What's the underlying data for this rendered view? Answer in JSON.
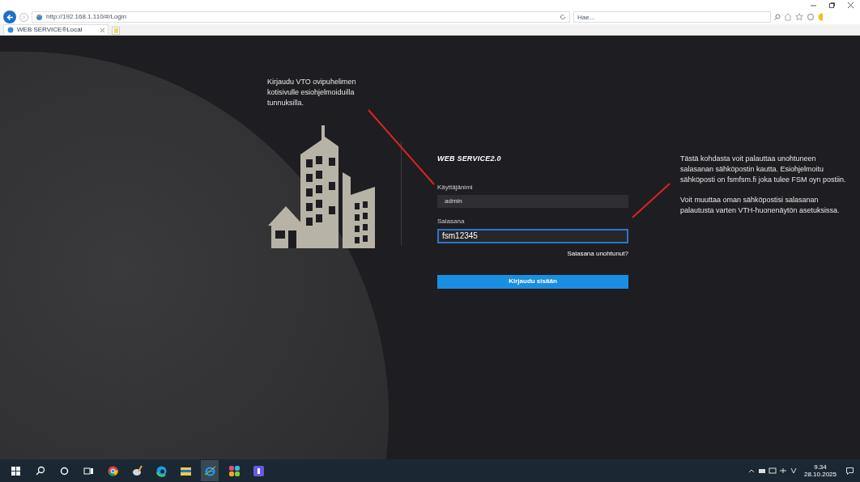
{
  "browser": {
    "url": "http://192.168.1.110/#/Login",
    "search": {
      "placeholder": "Hae..."
    },
    "tabs": [
      {
        "title": "WEB SERVICE®Local",
        "selected": true
      }
    ]
  },
  "annotations": [
    {
      "paragraphs": [
        "Kirjaudu VTO ovipuhelimen kotisivulle esiohjelmoiduilla tunnuksilla."
      ]
    },
    {
      "paragraphs": [
        "Tästä kohdasta voit palauttaa unohtuneen salasanan sähköpostin kautta. Esiohjelmoitu sähköposti on fsmfsm.fi joka tulee FSM oyn postiin.",
        "Voit muuttaa oman sähköpostisi salasanan palautusta varten VTH-huonenäytön asetuksissa."
      ]
    }
  ],
  "login": {
    "title": "WEB SERVICE2.0",
    "fields": [
      {
        "label": "Käyttäjänimi",
        "value": "admin",
        "focused": false
      },
      {
        "label": "Salasana",
        "value": "fsm12345",
        "focused": true
      }
    ],
    "forgot_link": "Salasana unohtunut?",
    "submit": "Kirjaudu sisään"
  },
  "taskbar": {
    "apps": [
      {
        "kind": "start",
        "selected": false
      },
      {
        "kind": "search",
        "selected": false
      },
      {
        "kind": "cortana",
        "selected": false
      },
      {
        "kind": "taskview",
        "selected": false
      },
      {
        "kind": "chrome",
        "selected": false
      },
      {
        "kind": "paint",
        "selected": false
      },
      {
        "kind": "edge",
        "selected": false
      },
      {
        "kind": "folder",
        "selected": false
      },
      {
        "kind": "ie",
        "selected": true
      },
      {
        "kind": "tiles",
        "selected": false
      },
      {
        "kind": "app",
        "selected": false
      }
    ],
    "clock": {
      "time": "9.34",
      "date": "28.10.2025"
    }
  }
}
